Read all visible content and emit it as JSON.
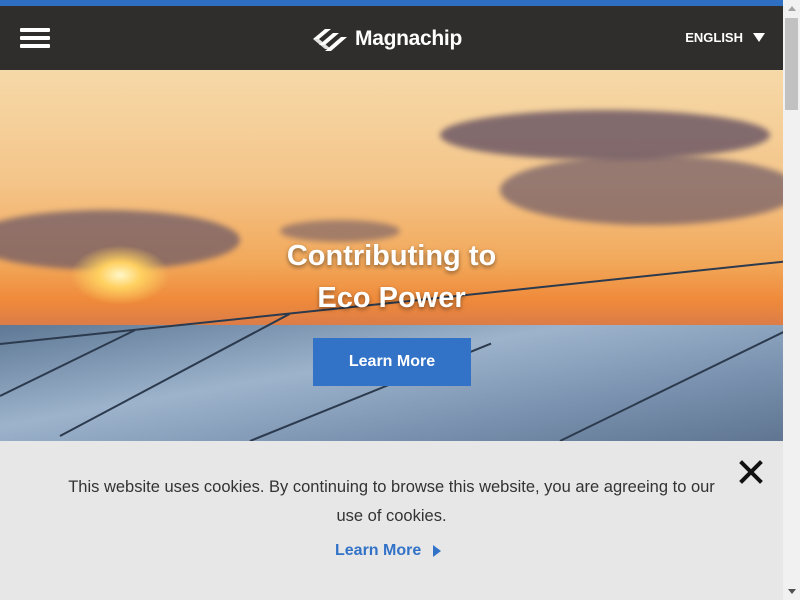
{
  "header": {
    "logo_text": "Magnachip",
    "language_label": "ENGLISH"
  },
  "hero": {
    "title_line1": "Contributing to",
    "title_line2": "Eco Power",
    "button_label": "Learn More"
  },
  "cookie_banner": {
    "message_line1": "This website uses cookies. By continuing to browse this website, you are agreeing to our",
    "message_line2": "use of cookies.",
    "link_label": "Learn More"
  },
  "colors": {
    "accent_blue": "#3273c8",
    "header_bg": "#2f2e2c",
    "cookie_bg": "#e7e7e7"
  },
  "icons": [
    "hamburger-menu-icon",
    "magnachip-logo-icon",
    "dropdown-triangle-icon",
    "close-icon",
    "right-triangle-icon"
  ]
}
